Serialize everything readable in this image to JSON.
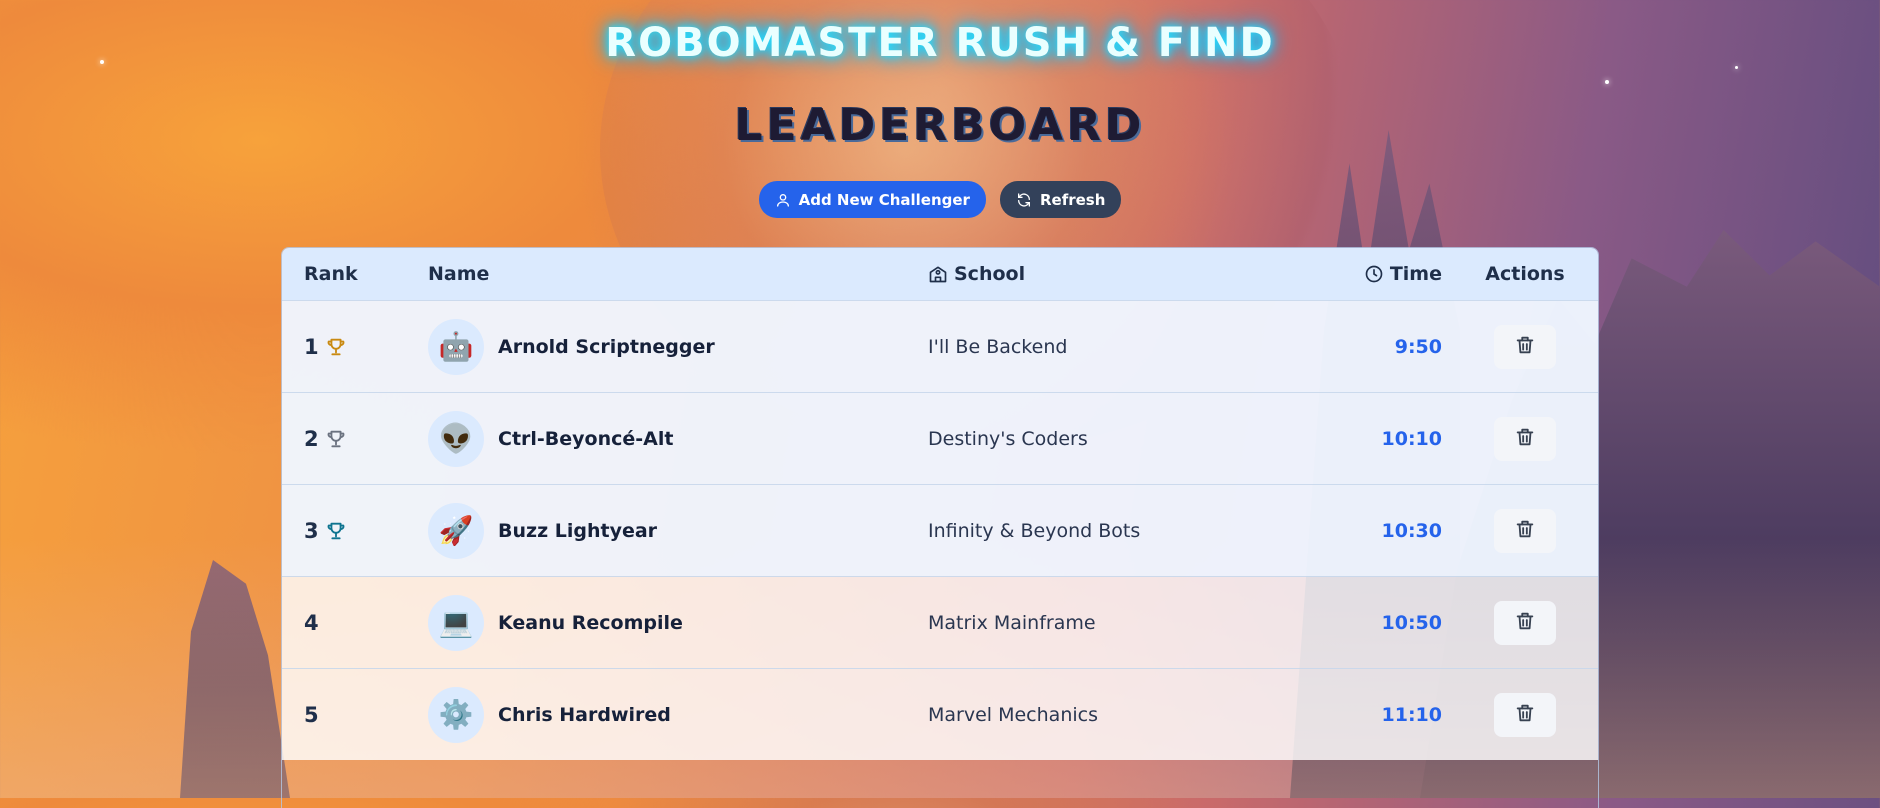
{
  "header": {
    "app_title": "ROBOMASTER RUSH & FIND",
    "board_title": "LEADERBOARD"
  },
  "toolbar": {
    "add_label": "Add New Challenger",
    "refresh_label": "Refresh"
  },
  "table": {
    "columns": {
      "rank": "Rank",
      "name": "Name",
      "school": "School",
      "time": "Time",
      "actions": "Actions"
    },
    "rows": [
      {
        "rank": "1",
        "name": "Arnold Scriptnegger",
        "avatar": "🤖",
        "school": "I'll Be Backend",
        "time": "9:50",
        "trophy_color": "#c98a12"
      },
      {
        "rank": "2",
        "name": "Ctrl-Beyoncé-Alt",
        "avatar": "👽",
        "school": "Destiny's Coders",
        "time": "10:10",
        "trophy_color": "#6b7280"
      },
      {
        "rank": "3",
        "name": "Buzz Lightyear",
        "avatar": "🚀",
        "school": "Infinity & Beyond Bots",
        "time": "10:30",
        "trophy_color": "#0e7490"
      },
      {
        "rank": "4",
        "name": "Keanu Recompile",
        "avatar": "💻",
        "school": "Matrix Mainframe",
        "time": "10:50"
      },
      {
        "rank": "5",
        "name": "Chris Hardwired",
        "avatar": "⚙️",
        "school": "Marvel Mechanics",
        "time": "11:10"
      }
    ]
  },
  "colors": {
    "primary": "#2563eb",
    "header_bg": "#dbeafe",
    "title_glow": "#25e0ff"
  }
}
